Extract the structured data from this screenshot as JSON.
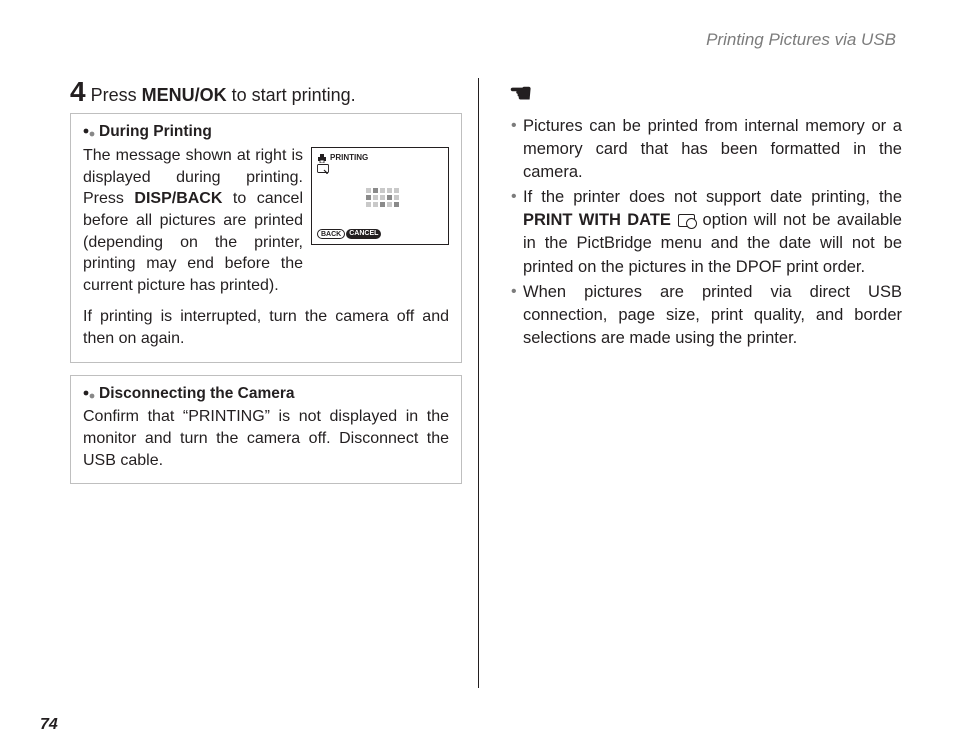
{
  "header": "Printing Pictures via USB",
  "step": {
    "num": "4",
    "before": "Press ",
    "bold": "MENU/OK",
    "after": " to start printing."
  },
  "box1": {
    "title": "During Printing",
    "body": "The message shown at right is displayed during printing. Press ",
    "bold1": "DISP/BACK",
    "body2": " to cancel before all pictures are printed (depending on the printer, printing may end before the current picture has printed).",
    "footer": "If printing is interrupted, turn the camera off and then on again."
  },
  "lcd": {
    "title": "PRINTING",
    "back": "BACK",
    "cancel": "CANCEL"
  },
  "box2": {
    "title": "Disconnecting the Camera",
    "body": "Confirm that “PRINTING” is not displayed in the monitor and turn the camera off.  Disconnect the USB cable."
  },
  "bullets": {
    "b1": "Pictures can be printed from internal memory or a memory card that has been formatted in the camera.",
    "b2a": "If the printer does not support date printing, the ",
    "b2bold": "PRINT WITH DATE",
    "b2b": " option will not be available in the PictBridge menu and the date will not be printed on the pictures in the DPOF print order.",
    "b3": "When pictures are printed via direct USB connection, page size, print quality, and border selections are made using the printer."
  },
  "pageNum": "74"
}
